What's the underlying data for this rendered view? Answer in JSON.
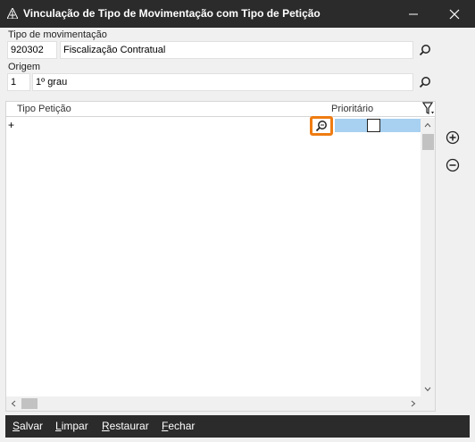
{
  "window": {
    "title": "Vinculação de Tipo de Movimentação com Tipo de Petição"
  },
  "tipo_movimentacao": {
    "label": "Tipo de movimentação",
    "code": "920302",
    "description": "Fiscalização Contratual"
  },
  "origem": {
    "label": "Origem",
    "code": "1",
    "description": "1º grau"
  },
  "grid": {
    "columns": [
      "Tipo Petição",
      "Prioritário"
    ],
    "rows": [
      {
        "marker": "+",
        "tipo_peticao": "",
        "prioritario": false
      }
    ]
  },
  "footer": {
    "buttons": [
      "Salvar",
      "Limpar",
      "Restaurar",
      "Fechar"
    ]
  },
  "colors": {
    "titlebar": "#2b2b2b",
    "selected_cell": "#a8d0f0",
    "highlight": "#ef7c12"
  }
}
